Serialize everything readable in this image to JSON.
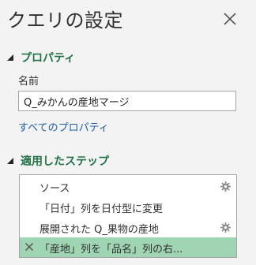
{
  "pane": {
    "title": "クエリの設定"
  },
  "properties": {
    "header": "プロパティ",
    "name_label": "名前",
    "name_value": "Q_みかんの産地マージ",
    "all_properties_link": "すべてのプロパティ"
  },
  "steps": {
    "header": "適用したステップ",
    "items": [
      {
        "label": "ソース",
        "has_settings": true
      },
      {
        "label": "「日付」列を日付型に変更",
        "has_settings": false
      },
      {
        "label": "展開された Q_果物の産地",
        "has_settings": true
      },
      {
        "label": "「産地」列を「品名」列の右...",
        "has_settings": false,
        "selected": true
      }
    ]
  },
  "colors": {
    "accent": "#217346",
    "link": "#1e5fa8",
    "selected_row": "#9fd5b3",
    "pane_bg": "#f3f3f3"
  },
  "icons": {
    "close": "close-icon",
    "collapse": "triangle-down-icon",
    "settings": "gear-icon",
    "delete": "delete-x-icon"
  }
}
